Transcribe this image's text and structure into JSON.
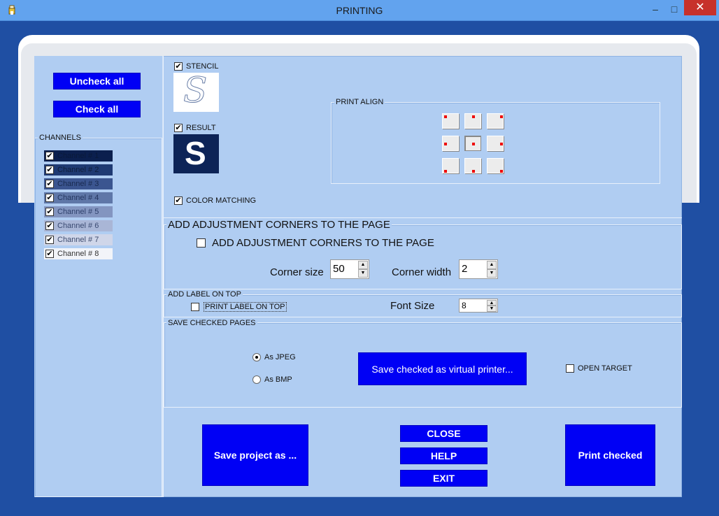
{
  "window": {
    "title": "PRINTING",
    "minimize": "–",
    "maximize": "□",
    "close": "✕"
  },
  "left": {
    "uncheck_all": "Uncheck all",
    "check_all": "Check all",
    "channels_label": "CHANNELS",
    "channels": [
      {
        "label": "Channel # 1",
        "checked": true,
        "color": "#0b1f4e",
        "text": "#0a1a3a"
      },
      {
        "label": "Channel # 2",
        "checked": true,
        "color": "#1f3a73",
        "text": "#0f1e3c"
      },
      {
        "label": "Channel # 3",
        "checked": true,
        "color": "#3b5590",
        "text": "#182a4f"
      },
      {
        "label": "Channel # 4",
        "checked": true,
        "color": "#5f77a8",
        "text": "#243660"
      },
      {
        "label": "Channel # 5",
        "checked": true,
        "color": "#8395c0",
        "text": "#2d3f6a"
      },
      {
        "label": "Channel # 6",
        "checked": true,
        "color": "#a9b6d6",
        "text": "#3a4a72"
      },
      {
        "label": "Channel # 7",
        "checked": true,
        "color": "#cfd6e9",
        "text": "#3d4b6e"
      },
      {
        "label": "Channel # 8",
        "checked": true,
        "color": "#f2f4f9",
        "text": "#333"
      }
    ]
  },
  "options": {
    "stencil": "STENCIL",
    "stencil_glyph": "S",
    "result": "RESULT",
    "result_glyph": "S",
    "color_matching": "COLOR MATCHING",
    "print_align": "PRINT ALIGN",
    "check_mark": "✔"
  },
  "corners": {
    "group_label": "ADD ADJUSTMENT CORNERS TO THE PAGE",
    "checkbox_label": "ADD ADJUSTMENT  CORNERS TO THE  PAGE",
    "corner_size_label": "Corner size",
    "corner_size_value": "50",
    "corner_width_label": "Corner width",
    "corner_width_value": "2"
  },
  "label_top": {
    "group_label": "ADD LABEL ON TOP",
    "checkbox_label": "PRINT  LABEL ON TOP",
    "font_size_label": "Font Size",
    "font_size_value": "8"
  },
  "save": {
    "group_label": "SAVE CHECKED PAGES",
    "as_jpeg": "As  JPEG",
    "as_bmp": "As BMP",
    "save_virtual": "Save checked as virtual printer...",
    "open_target": "OPEN TARGET"
  },
  "bottom": {
    "save_project": "Save project as ...",
    "close": "CLOSE",
    "help": "HELP",
    "exit": "EXIT",
    "print_checked": "Print checked"
  },
  "spin_up": "▲",
  "spin_down": "▼"
}
